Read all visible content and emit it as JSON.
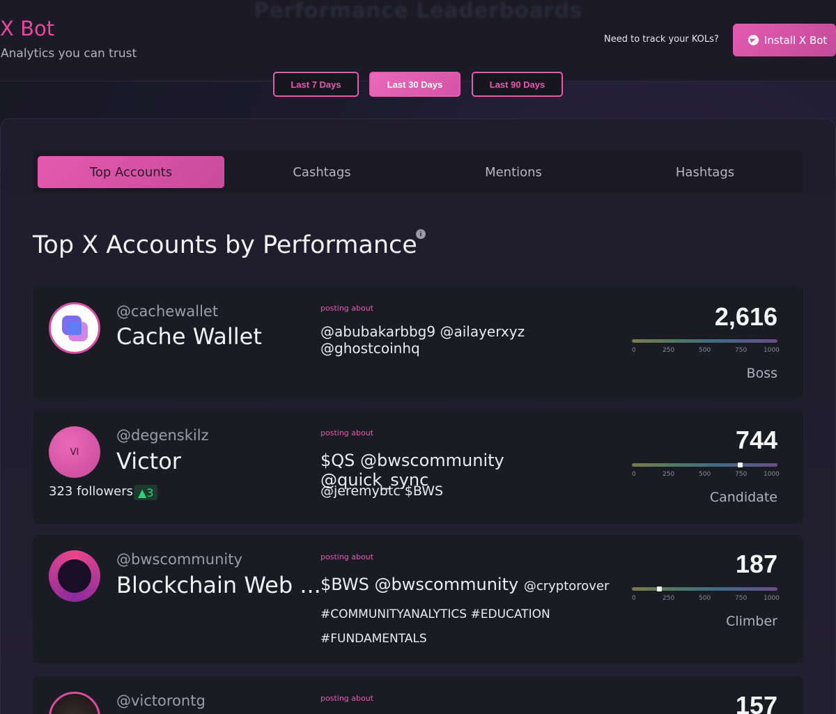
{
  "header": {
    "ghost_title": "Performance Leaderboards",
    "brand": "X Bot",
    "tagline": "Analytics you can trust",
    "kol_prompt": "Need to track your KOLs?",
    "install_label": "Install X Bot"
  },
  "periods": [
    {
      "label": "Last 7 Days",
      "active": false
    },
    {
      "label": "Last 30 Days",
      "active": true
    },
    {
      "label": "Last 90 Days",
      "active": false
    }
  ],
  "tabs": [
    {
      "label": "Top Accounts",
      "active": true
    },
    {
      "label": "Cashtags",
      "active": false
    },
    {
      "label": "Mentions",
      "active": false
    },
    {
      "label": "Hashtags",
      "active": false
    }
  ],
  "section": {
    "title": "Top X Accounts by Performance",
    "info_icon": "info-icon"
  },
  "scale": {
    "ticks": [
      "0",
      "250",
      "500",
      "750",
      "1000"
    ]
  },
  "accounts": [
    {
      "handle": "@cachewallet",
      "name": "Cache Wallet",
      "posting_label": "posting about",
      "topics_line1": "@abubakarbbg9 @ailayerxyz @ghostcoinhq",
      "score": "2,616",
      "rank": "Boss"
    },
    {
      "handle": "@degenskilz",
      "name": "Victor",
      "avatar_initials": "VI",
      "followers": "323 followers",
      "follower_delta": "▲3",
      "posting_label": "posting about",
      "topics_line1": "$QS @bwscommunity @quick_sync",
      "topics_line2": "@jeremybtc $BWS",
      "score": "744",
      "score_value": 744,
      "rank": "Candidate"
    },
    {
      "handle": "@bwscommunity",
      "name": "Blockchain Web ...",
      "posting_label": "posting about",
      "topics_line1a": "$BWS @bwscommunity",
      "topics_line1b": "@cryptorover",
      "topics_line2": "#COMMUNITYANALYTICS #EDUCATION",
      "topics_line3": "#FUNDAMENTALS",
      "score": "187",
      "score_value": 187,
      "rank": "Climber"
    },
    {
      "handle": "@victorontg",
      "posting_label": "posting about",
      "score": "157"
    }
  ],
  "colors": {
    "accent": "#e45bb0",
    "positive": "#2fd17a"
  }
}
